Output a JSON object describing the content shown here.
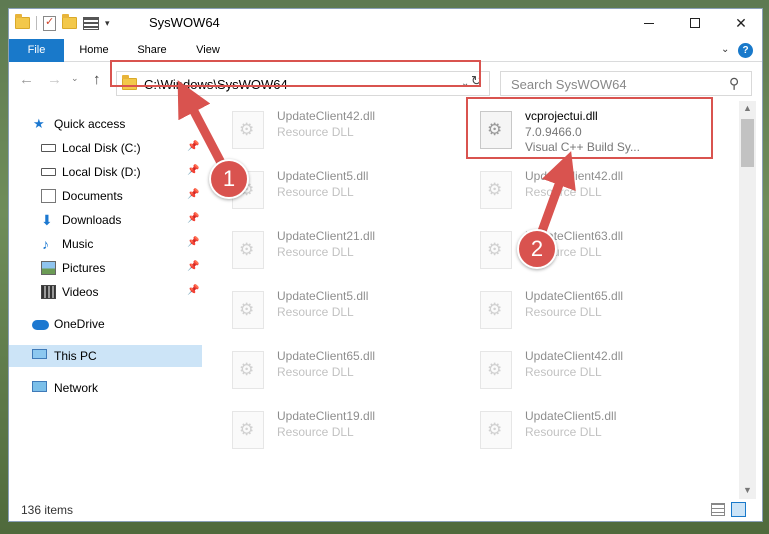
{
  "window": {
    "title": "SysWOW64"
  },
  "ribbon": {
    "tabs": [
      {
        "label": "File"
      },
      {
        "label": "Share"
      },
      {
        "label": "Home"
      },
      {
        "label": "View"
      }
    ],
    "file_label": "File",
    "home_label": "Home",
    "share_label": "Share",
    "view_label": "View",
    "help_glyph": "?"
  },
  "address": {
    "path": "C:\\Windows\\SysWOW64",
    "search_placeholder": "Search SysWOW64"
  },
  "sidebar": {
    "items": [
      {
        "label": "Quick access",
        "icon": "star-icon"
      },
      {
        "label": "Local Disk (C:)",
        "icon": "drive-icon"
      },
      {
        "label": "Local Disk (D:)",
        "icon": "drive-icon"
      },
      {
        "label": "Documents",
        "icon": "documents-icon"
      },
      {
        "label": "Downloads",
        "icon": "download-icon"
      },
      {
        "label": "Music",
        "icon": "music-icon"
      },
      {
        "label": "Pictures",
        "icon": "pictures-icon"
      },
      {
        "label": "Videos",
        "icon": "videos-icon"
      },
      {
        "label": "OneDrive",
        "icon": "cloud-icon"
      },
      {
        "label": "This PC",
        "icon": "computer-icon",
        "selected": true
      },
      {
        "label": "Network",
        "icon": "network-icon"
      }
    ]
  },
  "files": {
    "left": [
      {
        "name": "UpdateClient42.dll",
        "type": "Resource DLL"
      },
      {
        "name": "UpdateClient5.dll",
        "type": "Resource DLL"
      },
      {
        "name": "UpdateClient21.dll",
        "type": "Resource DLL"
      },
      {
        "name": "UpdateClient5.dll",
        "type": "Resource DLL"
      },
      {
        "name": "UpdateClient65.dll",
        "type": "Resource DLL"
      },
      {
        "name": "UpdateClient19.dll",
        "type": "Resource DLL"
      }
    ],
    "right": [
      {
        "name": "vcprojectui.dll",
        "type": "7.0.9466.0",
        "desc": "Visual C++ Build Sy..."
      },
      {
        "name": "UpdateClient42.dll",
        "type": "Resource DLL"
      },
      {
        "name": "UpdateClient63.dll",
        "type": "Resource DLL"
      },
      {
        "name": "UpdateClient65.dll",
        "type": "Resource DLL"
      },
      {
        "name": "UpdateClient42.dll",
        "type": "Resource DLL"
      },
      {
        "name": "UpdateClient5.dll",
        "type": "Resource DLL"
      }
    ]
  },
  "status": {
    "item_count": "136 items"
  },
  "callouts": {
    "step1": "1",
    "step2": "2"
  },
  "colors": {
    "accent": "#1979ca",
    "callout": "#d9534f",
    "selection": "#cce4f7"
  }
}
